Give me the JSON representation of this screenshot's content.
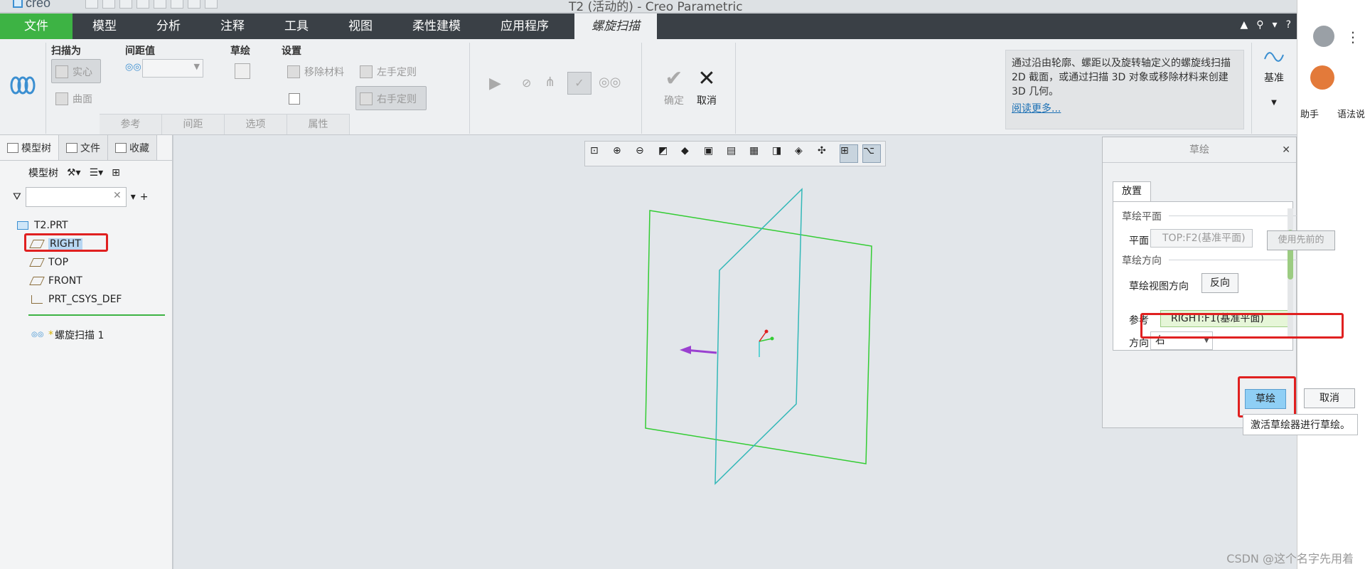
{
  "app": {
    "logo": "creo",
    "window_title": "T2 (活动的) - Creo Parametric"
  },
  "menu": {
    "file": "文件",
    "items": [
      "模型",
      "分析",
      "注释",
      "工具",
      "视图",
      "柔性建模",
      "应用程序"
    ],
    "active_tab": "螺旋扫描"
  },
  "ribbon": {
    "sweep_as": "扫描为",
    "solid": "实心",
    "surface": "曲面",
    "pitch": "间距值",
    "sketch": "草绘",
    "settings": "设置",
    "remove_material": "移除材料",
    "left_hand": "左手定则",
    "right_hand": "右手定则",
    "sub_tabs": [
      "参考",
      "间距",
      "选项",
      "属性"
    ],
    "ok": "确定",
    "cancel": "取消",
    "info_text": "通过沿由轮廓、螺距以及旋转轴定义的螺旋线扫描 2D 截面，或通过扫描 3D 对象或移除材料来创建 3D 几何。",
    "info_link": "阅读更多...",
    "datum": "基准"
  },
  "side": {
    "item1": "助手",
    "item2": "语法说"
  },
  "left_panel": {
    "tabs": [
      "模型树",
      "文件",
      "收藏"
    ],
    "toolbar_label": "模型树",
    "tree": {
      "root": "T2.PRT",
      "items": [
        "RIGHT",
        "TOP",
        "FRONT",
        "PRT_CSYS_DEF"
      ],
      "feature": "螺旋扫描 1"
    }
  },
  "dialog": {
    "title": "草绘",
    "tab": "放置",
    "sketch_plane_group": "草绘平面",
    "plane_label": "平面",
    "plane_value": "TOP:F2(基准平面)",
    "use_previous": "使用先前的",
    "orientation_group": "草绘方向",
    "view_dir_label": "草绘视图方向",
    "flip": "反向",
    "reference_label": "参考",
    "reference_value": "RIGHT:F1(基准平面)",
    "direction_label": "方向",
    "direction_value": "右",
    "sketch_button": "草绘",
    "cancel_button": "取消",
    "tooltip": "激活草绘器进行草绘。"
  },
  "watermark": "CSDN @这个名字先用着",
  "colors": {
    "file_menu": "#3db344",
    "menubar": "#3a4046",
    "highlight_box": "#e02020",
    "primary_button": "#8fcff5",
    "plane_green": "#33cc33",
    "plane_cyan": "#33b8b8"
  }
}
